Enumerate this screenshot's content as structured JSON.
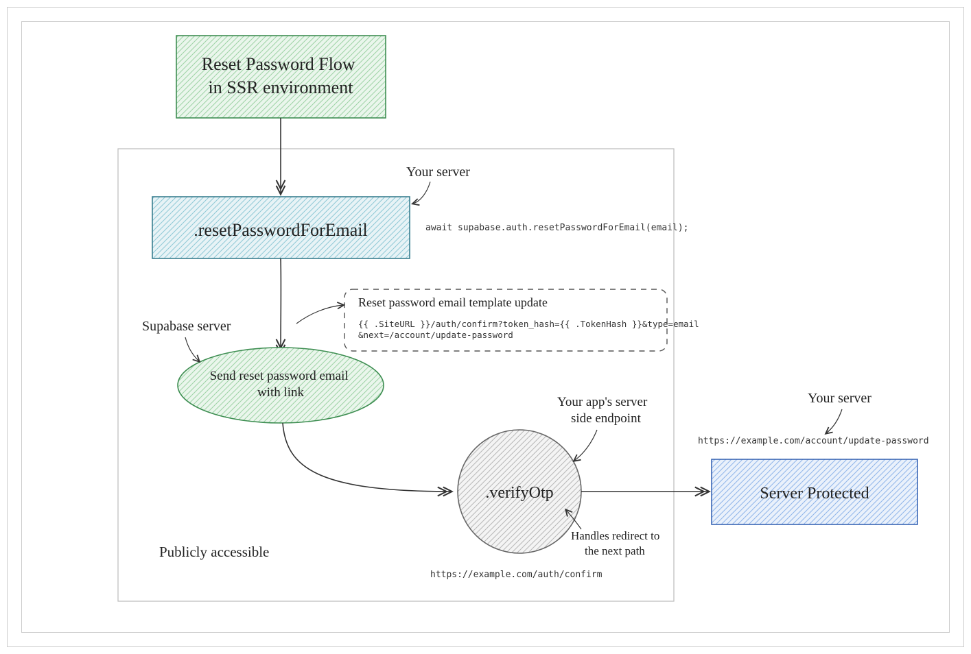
{
  "title": "Reset Password Flow\nin SSR environment",
  "nodes": {
    "resetPasswordForEmail": ".resetPasswordForEmail",
    "sendEmail": "Send reset password email\nwith link",
    "verifyOtp": ".verifyOtp",
    "serverProtected": "Server Protected"
  },
  "annotations": {
    "yourServer1": "Your server",
    "codeReset": "await supabase.auth.resetPasswordForEmail(email);",
    "supabaseServer": "Supabase server",
    "templateTitle": "Reset password email template update",
    "templateBody": "{{ .SiteURL }}/auth/confirm?token_hash={{ .TokenHash }}&type=email\n&next=/account/update-password",
    "publiclyAccessible": "Publicly accessible",
    "appsEndpoint": "Your app's server\nside endpoint",
    "redirectNote": "Handles redirect to\nthe next path",
    "confirmUrl": "https://example.com/auth/confirm",
    "yourServer2": "Your server",
    "updatePwUrl": "https://example.com/account/update-password"
  }
}
